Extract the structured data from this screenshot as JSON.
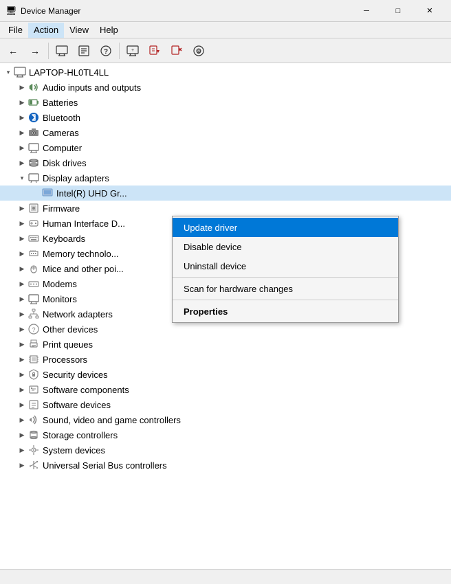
{
  "titleBar": {
    "icon": "🖥",
    "title": "Device Manager",
    "minimizeLabel": "─",
    "maximizeLabel": "□",
    "closeLabel": "✕"
  },
  "menuBar": {
    "items": [
      {
        "label": "File",
        "active": false
      },
      {
        "label": "Action",
        "active": true
      },
      {
        "label": "View",
        "active": false
      },
      {
        "label": "Help",
        "active": false
      }
    ]
  },
  "toolbar": {
    "buttons": [
      {
        "name": "back",
        "icon": "←",
        "disabled": false
      },
      {
        "name": "forward",
        "icon": "→",
        "disabled": false
      },
      {
        "name": "computer",
        "icon": "🖥",
        "disabled": false
      },
      {
        "name": "properties",
        "icon": "📋",
        "disabled": false
      },
      {
        "name": "help",
        "icon": "❓",
        "disabled": false
      },
      {
        "name": "monitor",
        "icon": "🖥",
        "disabled": false
      },
      {
        "name": "update",
        "icon": "⬇",
        "disabled": false
      },
      {
        "name": "remove",
        "icon": "✖",
        "disabled": false
      },
      {
        "name": "scan",
        "icon": "⊕",
        "disabled": false
      }
    ]
  },
  "tree": {
    "root": {
      "label": "LAPTOP-HL0TL4LL",
      "expanded": true,
      "children": [
        {
          "label": "Audio inputs and outputs",
          "icon": "🔊",
          "indent": 1,
          "expanded": false
        },
        {
          "label": "Batteries",
          "icon": "🔋",
          "indent": 1,
          "expanded": false
        },
        {
          "label": "Bluetooth",
          "icon": "🔵",
          "indent": 1,
          "expanded": false
        },
        {
          "label": "Cameras",
          "icon": "📷",
          "indent": 1,
          "expanded": false
        },
        {
          "label": "Computer",
          "icon": "🖥",
          "indent": 1,
          "expanded": false
        },
        {
          "label": "Disk drives",
          "icon": "💾",
          "indent": 1,
          "expanded": false
        },
        {
          "label": "Display adapters",
          "icon": "🖥",
          "indent": 1,
          "expanded": true,
          "children": [
            {
              "label": "Intel(R) UHD Gr...",
              "icon": "🖥",
              "indent": 2,
              "selected": true
            }
          ]
        },
        {
          "label": "Firmware",
          "icon": "⚙",
          "indent": 1,
          "expanded": false
        },
        {
          "label": "Human Interface D...",
          "icon": "⌨",
          "indent": 1,
          "expanded": false
        },
        {
          "label": "Keyboards",
          "icon": "⌨",
          "indent": 1,
          "expanded": false
        },
        {
          "label": "Memory technolo...",
          "icon": "💾",
          "indent": 1,
          "expanded": false
        },
        {
          "label": "Mice and other poi...",
          "icon": "🖱",
          "indent": 1,
          "expanded": false
        },
        {
          "label": "Modems",
          "icon": "📡",
          "indent": 1,
          "expanded": false
        },
        {
          "label": "Monitors",
          "icon": "🖥",
          "indent": 1,
          "expanded": false
        },
        {
          "label": "Network adapters",
          "icon": "🌐",
          "indent": 1,
          "expanded": false
        },
        {
          "label": "Other devices",
          "icon": "❓",
          "indent": 1,
          "expanded": false
        },
        {
          "label": "Print queues",
          "icon": "🖨",
          "indent": 1,
          "expanded": false
        },
        {
          "label": "Processors",
          "icon": "⚙",
          "indent": 1,
          "expanded": false
        },
        {
          "label": "Security devices",
          "icon": "🔒",
          "indent": 1,
          "expanded": false
        },
        {
          "label": "Software components",
          "icon": "📦",
          "indent": 1,
          "expanded": false
        },
        {
          "label": "Software devices",
          "icon": "💻",
          "indent": 1,
          "expanded": false
        },
        {
          "label": "Sound, video and game controllers",
          "icon": "🔊",
          "indent": 1,
          "expanded": false
        },
        {
          "label": "Storage controllers",
          "icon": "💾",
          "indent": 1,
          "expanded": false
        },
        {
          "label": "System devices",
          "icon": "⚙",
          "indent": 1,
          "expanded": false
        },
        {
          "label": "Universal Serial Bus controllers",
          "icon": "🔌",
          "indent": 1,
          "expanded": false
        }
      ]
    }
  },
  "contextMenu": {
    "items": [
      {
        "label": "Update driver",
        "highlighted": true,
        "bold": false,
        "separator": false
      },
      {
        "label": "Disable device",
        "highlighted": false,
        "bold": false,
        "separator": false
      },
      {
        "label": "Uninstall device",
        "highlighted": false,
        "bold": false,
        "separator": false
      },
      {
        "label": "",
        "separator": true
      },
      {
        "label": "Scan for hardware changes",
        "highlighted": false,
        "bold": false,
        "separator": false
      },
      {
        "label": "",
        "separator": true
      },
      {
        "label": "Properties",
        "highlighted": false,
        "bold": true,
        "separator": false
      }
    ]
  },
  "statusBar": {
    "text": ""
  }
}
